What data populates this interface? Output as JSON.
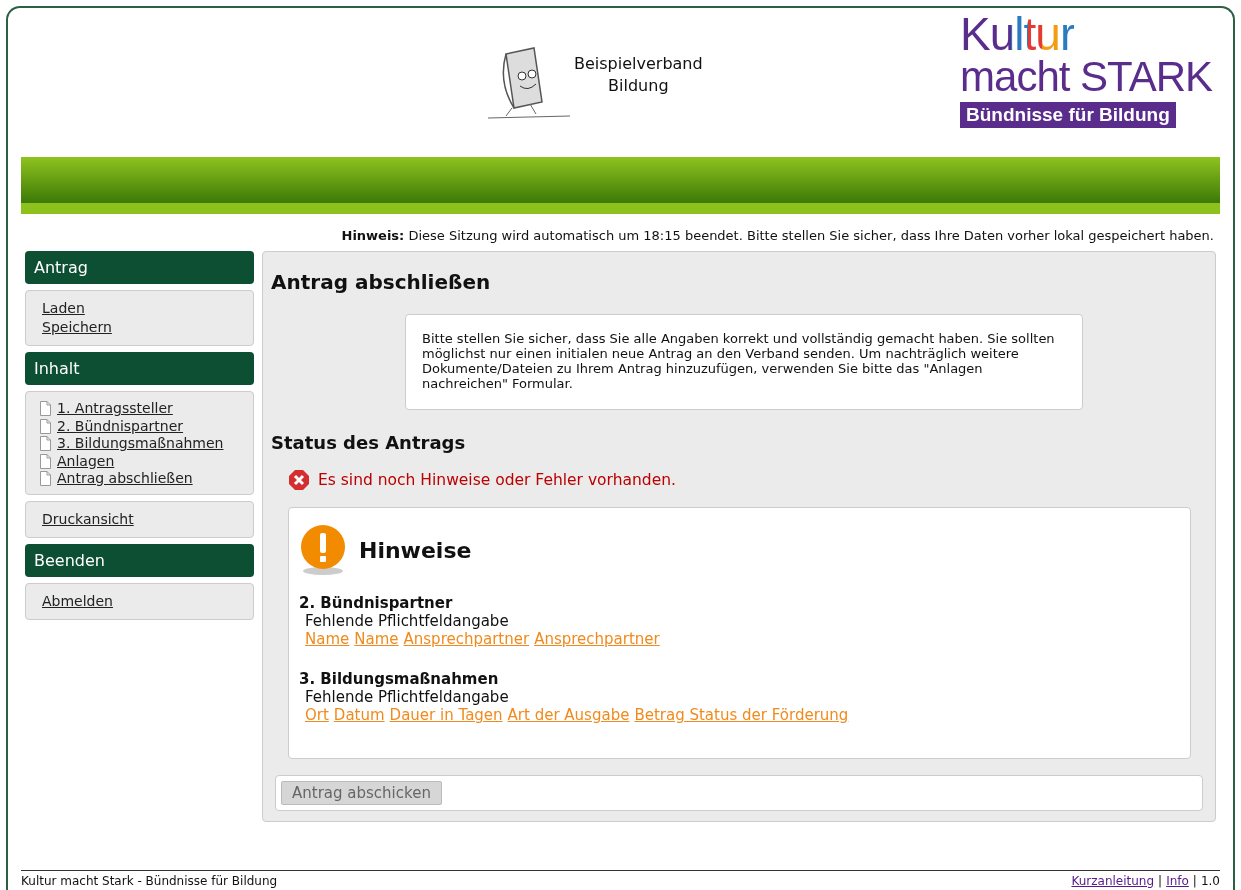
{
  "header": {
    "org_name": "Beispielverband\nBildung",
    "logo": {
      "line_1": "Kultur",
      "line_2": "macht STARK",
      "tagline": "Bündnisse für Bildung"
    }
  },
  "notice": {
    "label": "Hinweis:",
    "text": "Diese Sitzung wird automatisch um 18:15 beendet. Bitte stellen Sie sicher, dass Ihre Daten vorher lokal gespeichert haben."
  },
  "sidebar": [
    {
      "kind": "heading",
      "label": "Antrag"
    },
    {
      "kind": "links",
      "items": [
        {
          "label": "Laden"
        },
        {
          "label": "Speichern"
        }
      ]
    },
    {
      "kind": "heading",
      "label": "Inhalt"
    },
    {
      "kind": "pages",
      "items": [
        {
          "label": "1. Antragssteller"
        },
        {
          "label": "2. Bündnispartner"
        },
        {
          "label": "3. Bildungsmaßnahmen"
        },
        {
          "label": "Anlagen"
        },
        {
          "label": "Antrag abschließen"
        }
      ]
    },
    {
      "kind": "links",
      "items": [
        {
          "label": "Druckansicht"
        }
      ]
    },
    {
      "kind": "heading",
      "label": "Beenden"
    },
    {
      "kind": "links",
      "items": [
        {
          "label": "Abmelden"
        }
      ]
    }
  ],
  "main": {
    "title": "Antrag abschließen",
    "info": "Bitte stellen Sie sicher, dass Sie alle Angaben korrekt und vollständig gemacht haben. Sie sollten möglichst nur einen initialen neue Antrag an den Verband senden. Um nachträglich weitere Dokumente/Dateien zu Ihrem Antrag hinzuzufügen, verwenden Sie bitte das \"Anlagen nachreichen\" Formular.",
    "status_title": "Status des Antrags",
    "status_message": "Es sind noch Hinweise oder Fehler vorhanden.",
    "hints": {
      "title": "Hinweise",
      "sections": [
        {
          "title": "2. Bündnispartner",
          "subtitle": "Fehlende Pflichtfeldangabe",
          "links": [
            "Name",
            "Name",
            "Ansprechpartner",
            "Ansprechpartner"
          ]
        },
        {
          "title": "3. Bildungsmaßnahmen",
          "subtitle": "Fehlende Pflichtfeldangabe",
          "links": [
            "Ort",
            "Datum",
            "Dauer in Tagen",
            "Art der Ausgabe",
            "Betrag Status der Förderung"
          ]
        }
      ]
    },
    "submit": {
      "label": "Antrag abschicken",
      "disabled": true
    }
  },
  "footer": {
    "text": "Kultur macht Stark - Bündnisse für Bildung",
    "right": [
      {
        "kind": "link",
        "text": "Kurzanleitung"
      },
      {
        "kind": "separator",
        "text": "|"
      },
      {
        "kind": "link",
        "text": "Info"
      },
      {
        "kind": "separator",
        "text": "|"
      },
      {
        "kind": "version",
        "text": "1.0"
      }
    ]
  }
}
